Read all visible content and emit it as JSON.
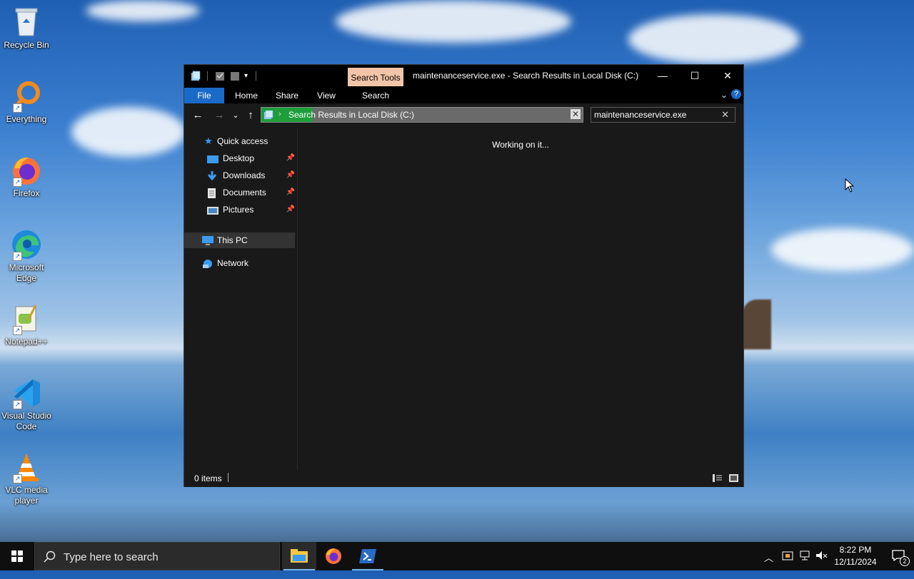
{
  "desktop": {
    "icons": [
      {
        "label": "Recycle Bin"
      },
      {
        "label": "Everything"
      },
      {
        "label": "Firefox"
      },
      {
        "label": "Microsoft Edge"
      },
      {
        "label": "Notepad++"
      },
      {
        "label": "Visual Studio Code"
      },
      {
        "label": "VLC media player"
      }
    ]
  },
  "window": {
    "contextual_tab": "Search Tools",
    "title": "maintenanceservice.exe - Search Results in Local Disk (C:)",
    "controls": {
      "minimize": "—",
      "maximize": "☐",
      "close": "✕"
    },
    "ribbon_tabs": [
      "File",
      "Home",
      "Share",
      "View",
      "Search"
    ],
    "address": {
      "text": "Search Results in Local Disk (C:)",
      "chevron": "›"
    },
    "search": {
      "value": "maintenanceservice.exe"
    },
    "nav": {
      "quick_access": "Quick access",
      "pinned": [
        "Desktop",
        "Downloads",
        "Documents",
        "Pictures"
      ],
      "this_pc": "This PC",
      "network": "Network"
    },
    "content": {
      "status_message": "Working on it..."
    },
    "statusbar": {
      "items": "0 items"
    }
  },
  "taskbar": {
    "search_placeholder": "Type here to search",
    "time": "8:22 PM",
    "date": "12/11/2024",
    "notification_count": "2"
  },
  "colors": {
    "accent": "#1a6ac9",
    "search_tools_tab": "#f3c5a8",
    "address_progress": "#1e9e3a"
  }
}
